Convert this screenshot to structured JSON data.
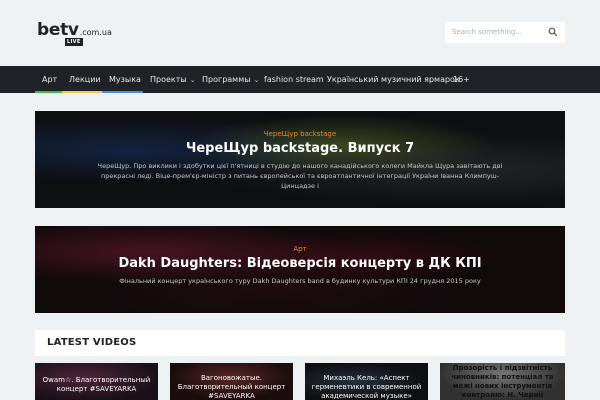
{
  "header": {
    "logo_main": "betv",
    "logo_domain": ".com.ua",
    "logo_badge": "LIVE",
    "search_placeholder": "Search something..."
  },
  "nav": {
    "items": [
      {
        "label": "Арт",
        "bar_color": "#4caf50"
      },
      {
        "label": "Лекции",
        "bar_color": "#f2c94c"
      },
      {
        "label": "Музыка",
        "bar_color": "#4a90d9"
      },
      {
        "label": "Проекты"
      },
      {
        "label": "Программы"
      },
      {
        "label": "fashion stream"
      },
      {
        "label": "Український музичний ярмарок"
      },
      {
        "label": "16+"
      }
    ]
  },
  "banners": [
    {
      "category": "ЧереЩур backstage",
      "title": "ЧереЩур backstage. Випуск 7",
      "desc_line1": "ЧереЩур. Про виклики і здобутки цієї п'ятниці в студію до нашого канадійського колеги Майкла Щура завітають дві",
      "desc_line2": "прекрасні леді. Віце-прем'єр-міністр з питань європейської та євроатлантичної інтеграції України Іванна Климпуш-Цинцадзе і"
    },
    {
      "category": "Арт",
      "title": "Dakh Daughters: Відеоверсія концерту в ДК КПІ",
      "desc_line1": "Фінальний концерт українського туру Dakh Daughters band в будинку культури КПІ 24 грудня 2015 року"
    }
  ],
  "latest": {
    "title": "LATEST VIDEOS",
    "videos": [
      {
        "title": "Оwam☆. Благотворительный концерт #SAVEYARKA"
      },
      {
        "title": "Вагоновожатые. Благотворительный концерт #SAVEYARKA"
      },
      {
        "title": "Михаэль Кель: «Аспект герменевтики в современной академической музыке»"
      },
      {
        "title": "Прозорість і підзвітність чиновників: потенціал та межі нових інструментів контролю: Н. Чернії"
      }
    ]
  },
  "colors": {
    "accent_orange": "#e58b2a",
    "nav_bg": "#1f2327"
  }
}
